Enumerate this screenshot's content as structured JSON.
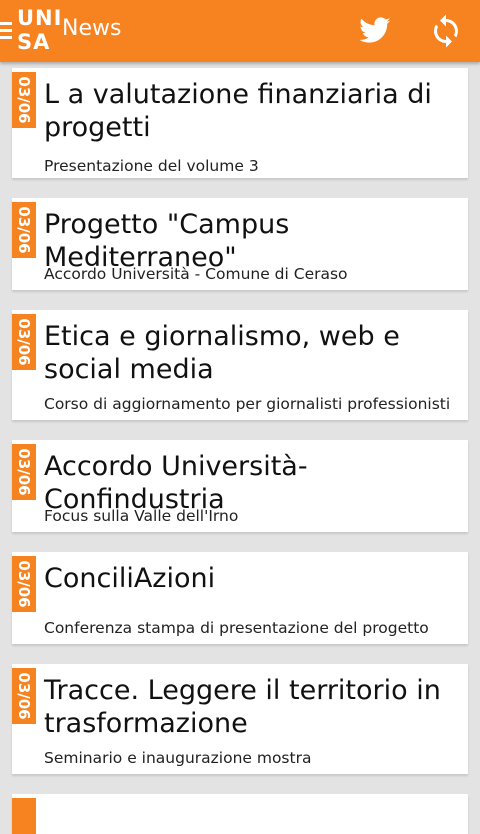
{
  "header": {
    "logo_top": "UNI",
    "logo_bottom": "SA",
    "title": "News",
    "twitter_icon": "twitter-bird-icon",
    "refresh_icon": "refresh-icon"
  },
  "colors": {
    "accent": "#f68220",
    "background": "#e3e3e3",
    "card": "#ffffff"
  },
  "news": [
    {
      "date": "03/06",
      "title": "L a valutazione finanziaria di progetti",
      "subtitle": "Presentazione del volume 3"
    },
    {
      "date": "03/06",
      "title": "Progetto \"Campus Mediterraneo\"",
      "subtitle": "Accordo Università - Comune di Ceraso"
    },
    {
      "date": "03/06",
      "title": "Etica e giornalismo, web e social media",
      "subtitle": "Corso di aggiornamento per giornalisti professionisti"
    },
    {
      "date": "03/06",
      "title": "Accordo Università-Confindustria",
      "subtitle": "Focus sulla Valle dell'Irno"
    },
    {
      "date": "03/06",
      "title": "ConciliAzioni",
      "subtitle": "Conferenza stampa di presentazione del progetto"
    },
    {
      "date": "03/06",
      "title": "Tracce. Leggere il territorio in trasformazione",
      "subtitle": "Seminario e inaugurazione mostra"
    }
  ]
}
